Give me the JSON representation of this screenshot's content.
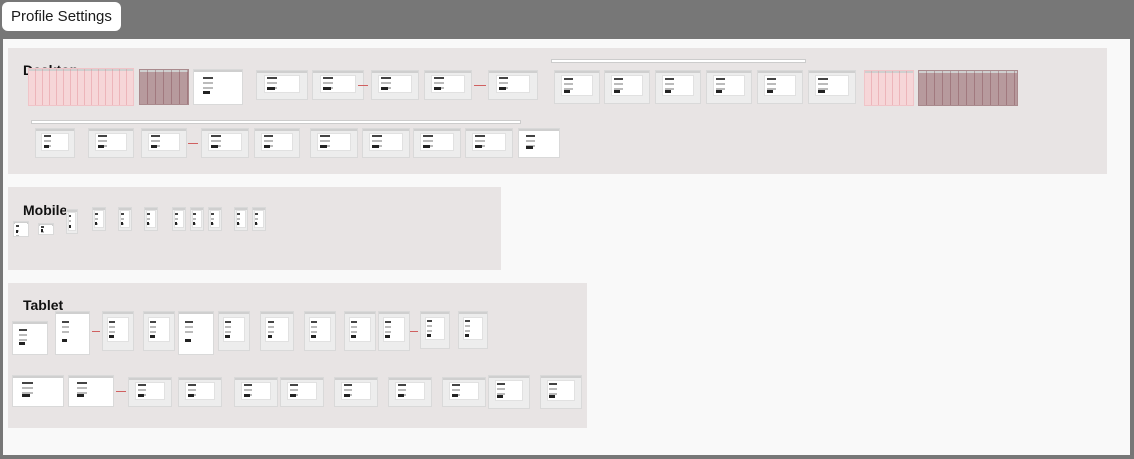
{
  "page": {
    "title": "Profile Settings"
  },
  "sections": [
    {
      "id": "desktop",
      "label": "Desktop"
    },
    {
      "id": "mobile",
      "label": "Mobile"
    },
    {
      "id": "tablet",
      "label": "Tablet"
    }
  ],
  "colors": {
    "window_bg": "#777777",
    "canvas_bg": "#f9f9f9",
    "section_bg": "#e8e4e4",
    "frame_pink": "#f6d6d8",
    "frame_darkpink": "#b79a9d",
    "connector": "#d06060"
  }
}
